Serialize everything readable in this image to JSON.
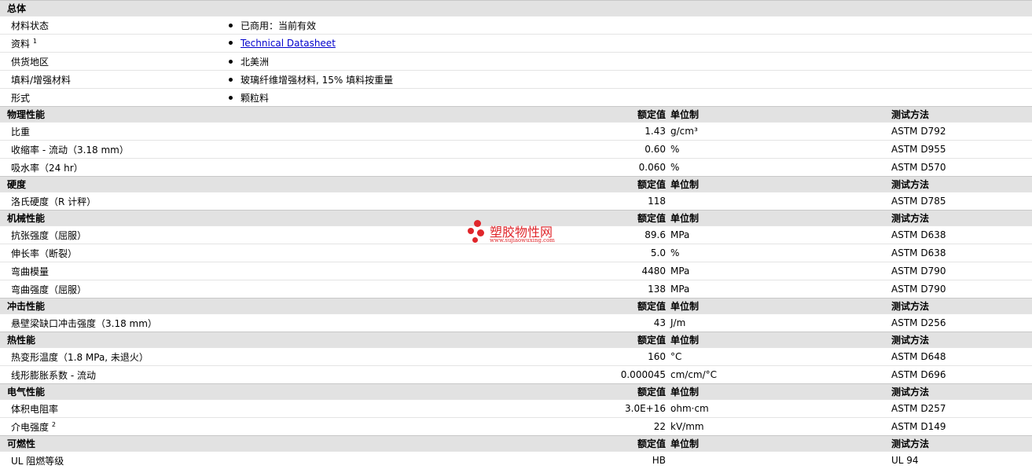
{
  "general": {
    "title": "总体",
    "rows": [
      {
        "label": "材料状态",
        "value": "已商用：当前有效"
      },
      {
        "label": "资料",
        "sup": "1",
        "link": "Technical Datasheet"
      },
      {
        "label": "供货地区",
        "value": "北美洲"
      },
      {
        "label": "填料/增强材料",
        "value": "玻璃纤维增强材料, 15% 填料按重量"
      },
      {
        "label": "形式",
        "value": "颗粒料"
      }
    ]
  },
  "headers": {
    "value": "额定值",
    "unit": "单位制",
    "test": "测试方法"
  },
  "physical": {
    "title": "物理性能",
    "rows": [
      {
        "label": "比重",
        "value": "1.43",
        "unit": "g/cm³",
        "test": "ASTM D792"
      },
      {
        "label": "收缩率 - 流动（3.18 mm）",
        "value": "0.60",
        "unit": "%",
        "test": "ASTM D955"
      },
      {
        "label": "吸水率（24 hr）",
        "value": "0.060",
        "unit": "%",
        "test": "ASTM D570"
      }
    ]
  },
  "hardness": {
    "title": "硬度",
    "rows": [
      {
        "label": "洛氏硬度（R 计秤）",
        "value": "118",
        "unit": "",
        "test": "ASTM D785"
      }
    ]
  },
  "mechanical": {
    "title": "机械性能",
    "rows": [
      {
        "label": "抗张强度（屈服）",
        "value": "89.6",
        "unit": "MPa",
        "test": "ASTM D638"
      },
      {
        "label": "伸长率（断裂）",
        "value": "5.0",
        "unit": "%",
        "test": "ASTM D638"
      },
      {
        "label": "弯曲模量",
        "value": "4480",
        "unit": "MPa",
        "test": "ASTM D790"
      },
      {
        "label": "弯曲强度（屈服）",
        "value": "138",
        "unit": "MPa",
        "test": "ASTM D790"
      }
    ]
  },
  "impact": {
    "title": "冲击性能",
    "rows": [
      {
        "label": "悬壁梁缺口冲击强度（3.18 mm）",
        "value": "43",
        "unit": "J/m",
        "test": "ASTM D256"
      }
    ]
  },
  "thermal": {
    "title": "热性能",
    "rows": [
      {
        "label": "热变形温度（1.8 MPa, 未退火）",
        "value": "160",
        "unit": "°C",
        "test": "ASTM D648"
      },
      {
        "label": "线形膨胀系数 - 流动",
        "value": "0.000045",
        "unit": "cm/cm/°C",
        "test": "ASTM D696"
      }
    ]
  },
  "electrical": {
    "title": "电气性能",
    "rows": [
      {
        "label": "体积电阻率",
        "value": "3.0E+16",
        "unit": "ohm·cm",
        "test": "ASTM D257"
      },
      {
        "label": "介电强度",
        "sup": "2",
        "value": "22",
        "unit": "kV/mm",
        "test": "ASTM D149"
      }
    ]
  },
  "flammability": {
    "title": "可燃性",
    "rows": [
      {
        "label": "UL 阻燃等级",
        "value": "HB",
        "unit": "",
        "test": "UL 94"
      }
    ]
  },
  "watermark": {
    "title": "塑胶物性网",
    "url": "www.sujiaowuxing.com",
    "color": "#e0262b"
  },
  "colors": {
    "section_bg": "#e2e2e2",
    "link": "#0000cc"
  }
}
